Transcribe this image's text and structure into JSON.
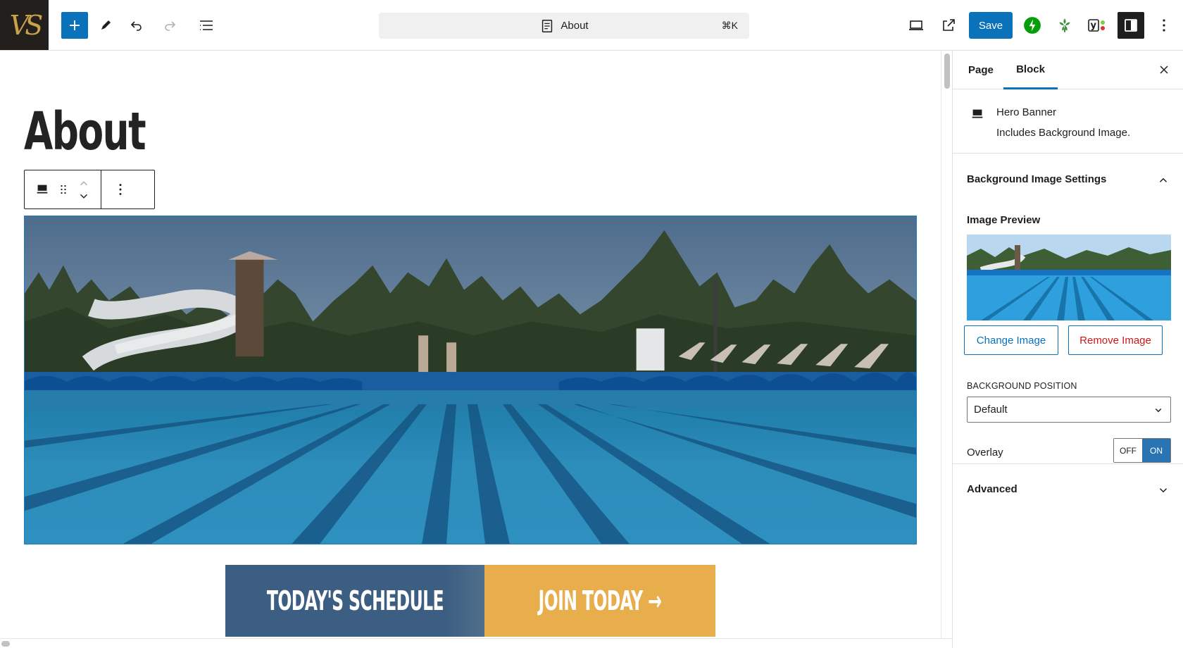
{
  "topbar": {
    "logo_text": "VS",
    "document_title": "About",
    "shortcut": "⌘K",
    "save_label": "Save",
    "accent": "#0a72ba"
  },
  "canvas": {
    "page_title": "About",
    "cta": [
      {
        "label": "TODAY'S SCHEDULE",
        "color": "#3c5e82"
      },
      {
        "label": "JOIN TODAY →",
        "color": "#e8ae4c"
      }
    ]
  },
  "sidebar": {
    "tabs": [
      "Page",
      "Block"
    ],
    "active_tab": "Block",
    "block": {
      "name": "Hero Banner",
      "description": "Includes Background Image."
    },
    "bg_settings": {
      "title": "Background Image Settings",
      "image_preview_label": "Image Preview",
      "change_image": "Change Image",
      "remove_image": "Remove Image",
      "position_label": "BACKGROUND POSITION",
      "position_value": "Default",
      "overlay_label": "Overlay",
      "toggle_off": "OFF",
      "toggle_on": "ON"
    },
    "advanced_label": "Advanced"
  }
}
